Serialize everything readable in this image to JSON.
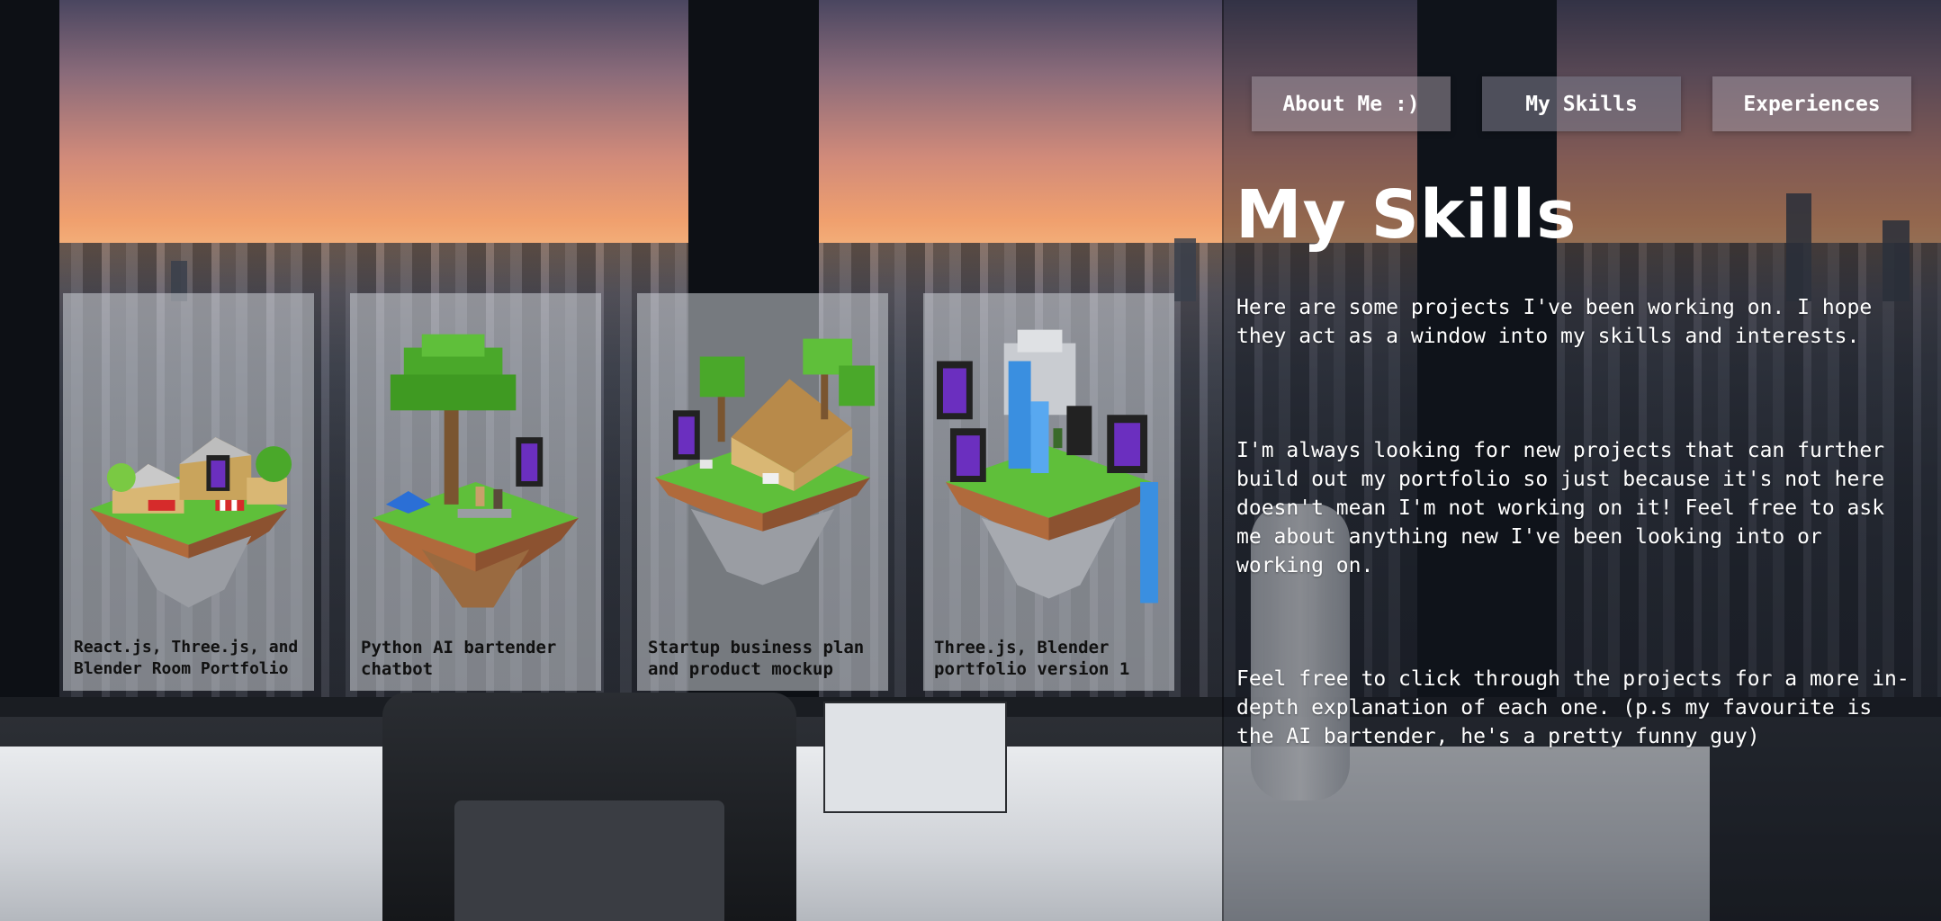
{
  "nav": {
    "about_label": "About Me :)",
    "skills_label": "My Skills",
    "experiences_label": "Experiences",
    "active": "My Skills"
  },
  "main": {
    "title": "My Skills",
    "paragraphs": [
      "Here are some projects I've been working on. I hope they act as a window into my skills and interests.",
      "I'm always looking for new projects that can further build out my portfolio so just because it's not here doesn't mean I'm not working on it! Feel free to ask me about anything new I've been looking into or working on.",
      "Feel free to click through the projects for a more in-depth explanation of each one. (p.s my favourite is the AI bartender, he's a pretty funny guy)"
    ]
  },
  "projects": [
    {
      "caption": "React.js, Three.js, and Blender Room Portfolio",
      "image": "voxel-village-island"
    },
    {
      "caption": "Python AI bartender chatbot",
      "image": "voxel-tree-island"
    },
    {
      "caption": "Startup business plan and product mockup",
      "image": "voxel-house-island"
    },
    {
      "caption": "Three.js, Blender portfolio version 1",
      "image": "voxel-waterfall-island"
    }
  ],
  "colors": {
    "card_bg": "#cdd2d7",
    "nav_bg": "#a096a0",
    "text": "#ffffff",
    "grass": "#5fbf3a",
    "dirt": "#b06a3c",
    "portal": "#6b2fbf",
    "water": "#3a8fe0"
  }
}
